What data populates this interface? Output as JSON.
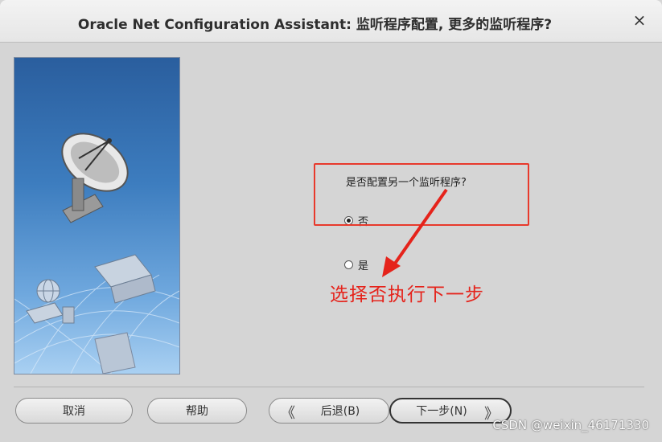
{
  "window": {
    "title": "Oracle Net Configuration Assistant: 监听程序配置, 更多的监听程序?",
    "close_glyph": "×"
  },
  "main": {
    "question": "是否配置另一个监听程序?",
    "options": [
      {
        "label": "否",
        "checked": true
      },
      {
        "label": "是",
        "checked": false
      }
    ]
  },
  "annotation": {
    "text": "选择否执行下一步",
    "color": "#e5231b"
  },
  "buttons": {
    "cancel": "取消",
    "help": "帮助",
    "back": "后退(B)",
    "next": "下一步(N)"
  },
  "watermark": "CSDN @weixin_46171330"
}
